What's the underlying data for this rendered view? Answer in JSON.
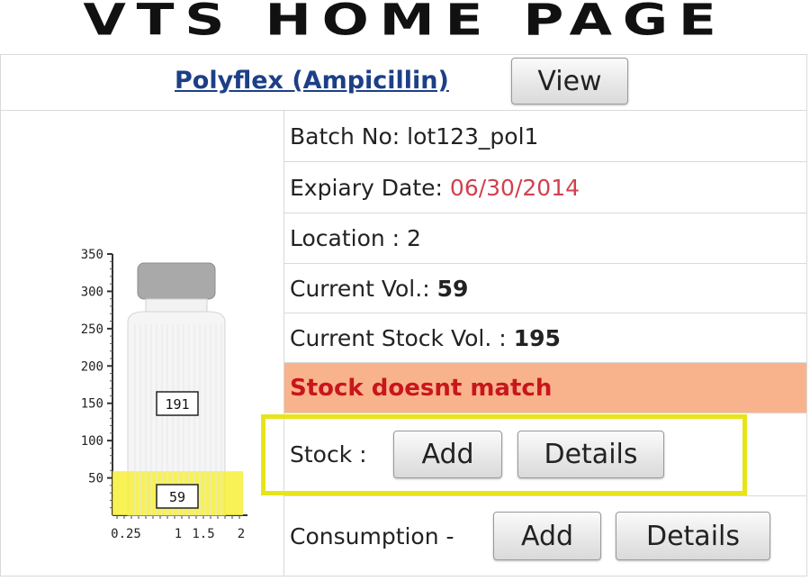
{
  "page": {
    "title": "VTS HOME PAGE"
  },
  "product": {
    "name": "Polyflex (Ampicillin)",
    "view_label": "View"
  },
  "details": {
    "batch_label": "Batch No: lot123_pol1",
    "expiry_label": "Expiary Date:",
    "expiry_value": "06/30/2014",
    "location_label": "Location : 2",
    "current_vol_label": "Current Vol.:",
    "current_vol_value": "59",
    "current_stock_label": "Current Stock Vol. :",
    "current_stock_value": "195",
    "alert": "Stock doesnt match"
  },
  "stock": {
    "label": "Stock :",
    "add_label": "Add",
    "details_label": "Details"
  },
  "consumption": {
    "label": "Consumption -",
    "add_label": "Add",
    "details_label": "Details"
  },
  "colors": {
    "alert_bg": "#f9b38c",
    "alert_text": "#c8161d",
    "expiry_text": "#d0414f",
    "highlight": "#e8e41a",
    "fill": "#f7f03a"
  },
  "chart_data": {
    "type": "gauge",
    "y_ticks": [
      "350",
      "300",
      "250",
      "200",
      "150",
      "100",
      "50"
    ],
    "x_ticks": [
      "0.25",
      "1",
      "1.5",
      "2"
    ],
    "ylim": [
      0,
      350
    ],
    "capacity_label": "191",
    "capacity": 191,
    "current_label": "59",
    "current": 59
  }
}
